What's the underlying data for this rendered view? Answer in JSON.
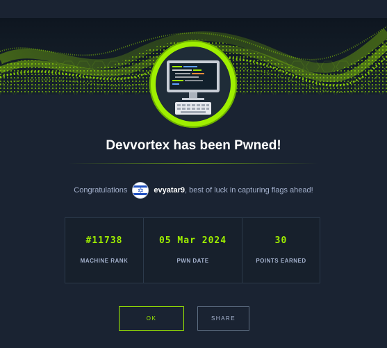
{
  "modal": {
    "title": "Devvortex has been Pwned!",
    "congrats_prefix": "Congratulations",
    "username": "evyatar9",
    "congrats_suffix": ", best of luck in capturing flags ahead!",
    "flag_icon": "israel-flag-icon",
    "machine_avatar_icon": "computer-monitor-icon"
  },
  "stats": [
    {
      "value": "#11738",
      "label": "MACHINE RANK"
    },
    {
      "value": "05 Mar 2024",
      "label": "PWN DATE"
    },
    {
      "value": "30",
      "label": "POINTS EARNED"
    }
  ],
  "buttons": {
    "ok_label": "OK",
    "share_label": "SHARE"
  },
  "colors": {
    "background": "#1a2332",
    "accent": "#9fef00",
    "text_muted": "#a4b1cd",
    "white": "#ffffff"
  }
}
